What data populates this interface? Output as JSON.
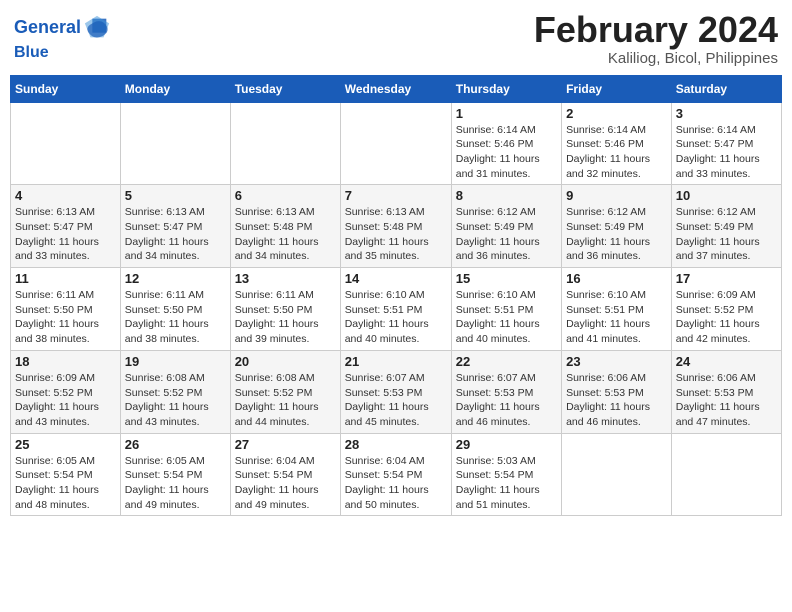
{
  "header": {
    "logo_line1": "General",
    "logo_line2": "Blue",
    "month_title": "February 2024",
    "location": "Kaliliog, Bicol, Philippines"
  },
  "days_of_week": [
    "Sunday",
    "Monday",
    "Tuesday",
    "Wednesday",
    "Thursday",
    "Friday",
    "Saturday"
  ],
  "weeks": [
    [
      {
        "num": "",
        "info": ""
      },
      {
        "num": "",
        "info": ""
      },
      {
        "num": "",
        "info": ""
      },
      {
        "num": "",
        "info": ""
      },
      {
        "num": "1",
        "info": "Sunrise: 6:14 AM\nSunset: 5:46 PM\nDaylight: 11 hours and 31 minutes."
      },
      {
        "num": "2",
        "info": "Sunrise: 6:14 AM\nSunset: 5:46 PM\nDaylight: 11 hours and 32 minutes."
      },
      {
        "num": "3",
        "info": "Sunrise: 6:14 AM\nSunset: 5:47 PM\nDaylight: 11 hours and 33 minutes."
      }
    ],
    [
      {
        "num": "4",
        "info": "Sunrise: 6:13 AM\nSunset: 5:47 PM\nDaylight: 11 hours and 33 minutes."
      },
      {
        "num": "5",
        "info": "Sunrise: 6:13 AM\nSunset: 5:47 PM\nDaylight: 11 hours and 34 minutes."
      },
      {
        "num": "6",
        "info": "Sunrise: 6:13 AM\nSunset: 5:48 PM\nDaylight: 11 hours and 34 minutes."
      },
      {
        "num": "7",
        "info": "Sunrise: 6:13 AM\nSunset: 5:48 PM\nDaylight: 11 hours and 35 minutes."
      },
      {
        "num": "8",
        "info": "Sunrise: 6:12 AM\nSunset: 5:49 PM\nDaylight: 11 hours and 36 minutes."
      },
      {
        "num": "9",
        "info": "Sunrise: 6:12 AM\nSunset: 5:49 PM\nDaylight: 11 hours and 36 minutes."
      },
      {
        "num": "10",
        "info": "Sunrise: 6:12 AM\nSunset: 5:49 PM\nDaylight: 11 hours and 37 minutes."
      }
    ],
    [
      {
        "num": "11",
        "info": "Sunrise: 6:11 AM\nSunset: 5:50 PM\nDaylight: 11 hours and 38 minutes."
      },
      {
        "num": "12",
        "info": "Sunrise: 6:11 AM\nSunset: 5:50 PM\nDaylight: 11 hours and 38 minutes."
      },
      {
        "num": "13",
        "info": "Sunrise: 6:11 AM\nSunset: 5:50 PM\nDaylight: 11 hours and 39 minutes."
      },
      {
        "num": "14",
        "info": "Sunrise: 6:10 AM\nSunset: 5:51 PM\nDaylight: 11 hours and 40 minutes."
      },
      {
        "num": "15",
        "info": "Sunrise: 6:10 AM\nSunset: 5:51 PM\nDaylight: 11 hours and 40 minutes."
      },
      {
        "num": "16",
        "info": "Sunrise: 6:10 AM\nSunset: 5:51 PM\nDaylight: 11 hours and 41 minutes."
      },
      {
        "num": "17",
        "info": "Sunrise: 6:09 AM\nSunset: 5:52 PM\nDaylight: 11 hours and 42 minutes."
      }
    ],
    [
      {
        "num": "18",
        "info": "Sunrise: 6:09 AM\nSunset: 5:52 PM\nDaylight: 11 hours and 43 minutes."
      },
      {
        "num": "19",
        "info": "Sunrise: 6:08 AM\nSunset: 5:52 PM\nDaylight: 11 hours and 43 minutes."
      },
      {
        "num": "20",
        "info": "Sunrise: 6:08 AM\nSunset: 5:52 PM\nDaylight: 11 hours and 44 minutes."
      },
      {
        "num": "21",
        "info": "Sunrise: 6:07 AM\nSunset: 5:53 PM\nDaylight: 11 hours and 45 minutes."
      },
      {
        "num": "22",
        "info": "Sunrise: 6:07 AM\nSunset: 5:53 PM\nDaylight: 11 hours and 46 minutes."
      },
      {
        "num": "23",
        "info": "Sunrise: 6:06 AM\nSunset: 5:53 PM\nDaylight: 11 hours and 46 minutes."
      },
      {
        "num": "24",
        "info": "Sunrise: 6:06 AM\nSunset: 5:53 PM\nDaylight: 11 hours and 47 minutes."
      }
    ],
    [
      {
        "num": "25",
        "info": "Sunrise: 6:05 AM\nSunset: 5:54 PM\nDaylight: 11 hours and 48 minutes."
      },
      {
        "num": "26",
        "info": "Sunrise: 6:05 AM\nSunset: 5:54 PM\nDaylight: 11 hours and 49 minutes."
      },
      {
        "num": "27",
        "info": "Sunrise: 6:04 AM\nSunset: 5:54 PM\nDaylight: 11 hours and 49 minutes."
      },
      {
        "num": "28",
        "info": "Sunrise: 6:04 AM\nSunset: 5:54 PM\nDaylight: 11 hours and 50 minutes."
      },
      {
        "num": "29",
        "info": "Sunrise: 5:03 AM\nSunset: 5:54 PM\nDaylight: 11 hours and 51 minutes."
      },
      {
        "num": "",
        "info": ""
      },
      {
        "num": "",
        "info": ""
      }
    ]
  ]
}
